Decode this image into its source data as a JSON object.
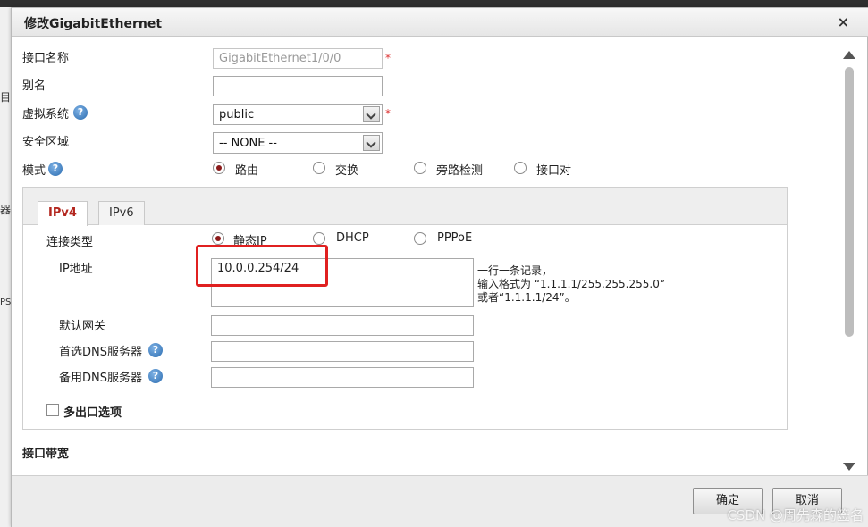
{
  "dialog": {
    "title": "修改GigabitEthernet",
    "close_symbol": "×"
  },
  "background": {
    "left_chars": [
      "目",
      "器",
      "PS"
    ]
  },
  "form": {
    "iface_name_label": "接口名称",
    "iface_name_value": "GigabitEthernet1/0/0",
    "alias_label": "别名",
    "alias_value": "",
    "vsys_label": "虚拟系统",
    "vsys_value": "public",
    "zone_label": "安全区域",
    "zone_value": "-- NONE --",
    "mode_label": "模式",
    "mode_options": [
      "路由",
      "交换",
      "旁路检测",
      "接口对"
    ],
    "mode_selected": "路由",
    "required_mark": "*",
    "help_symbol": "?"
  },
  "ip_panel": {
    "tabs": [
      "IPv4",
      "IPv6"
    ],
    "active_tab": "IPv4",
    "conn_type_label": "连接类型",
    "conn_type_options": [
      "静态IP",
      "DHCP",
      "PPPoE"
    ],
    "conn_type_selected": "静态IP",
    "ip_label": "IP地址",
    "ip_value": "10.0.0.254/24",
    "ip_hint_lines": [
      "一行一条记录，",
      "输入格式为 “1.1.1.1/255.255.255.0”",
      "或者“1.1.1.1/24”。"
    ],
    "gateway_label": "默认网关",
    "gateway_value": "",
    "dns1_label": "首选DNS服务器",
    "dns1_value": "",
    "dns2_label": "备用DNS服务器",
    "dns2_value": "",
    "multi_exit_label": "多出口选项"
  },
  "bandwidth_label": "接口带宽",
  "buttons": {
    "ok": "确定",
    "cancel": "取消"
  },
  "watermark": "CSDN @周先森的签名"
}
